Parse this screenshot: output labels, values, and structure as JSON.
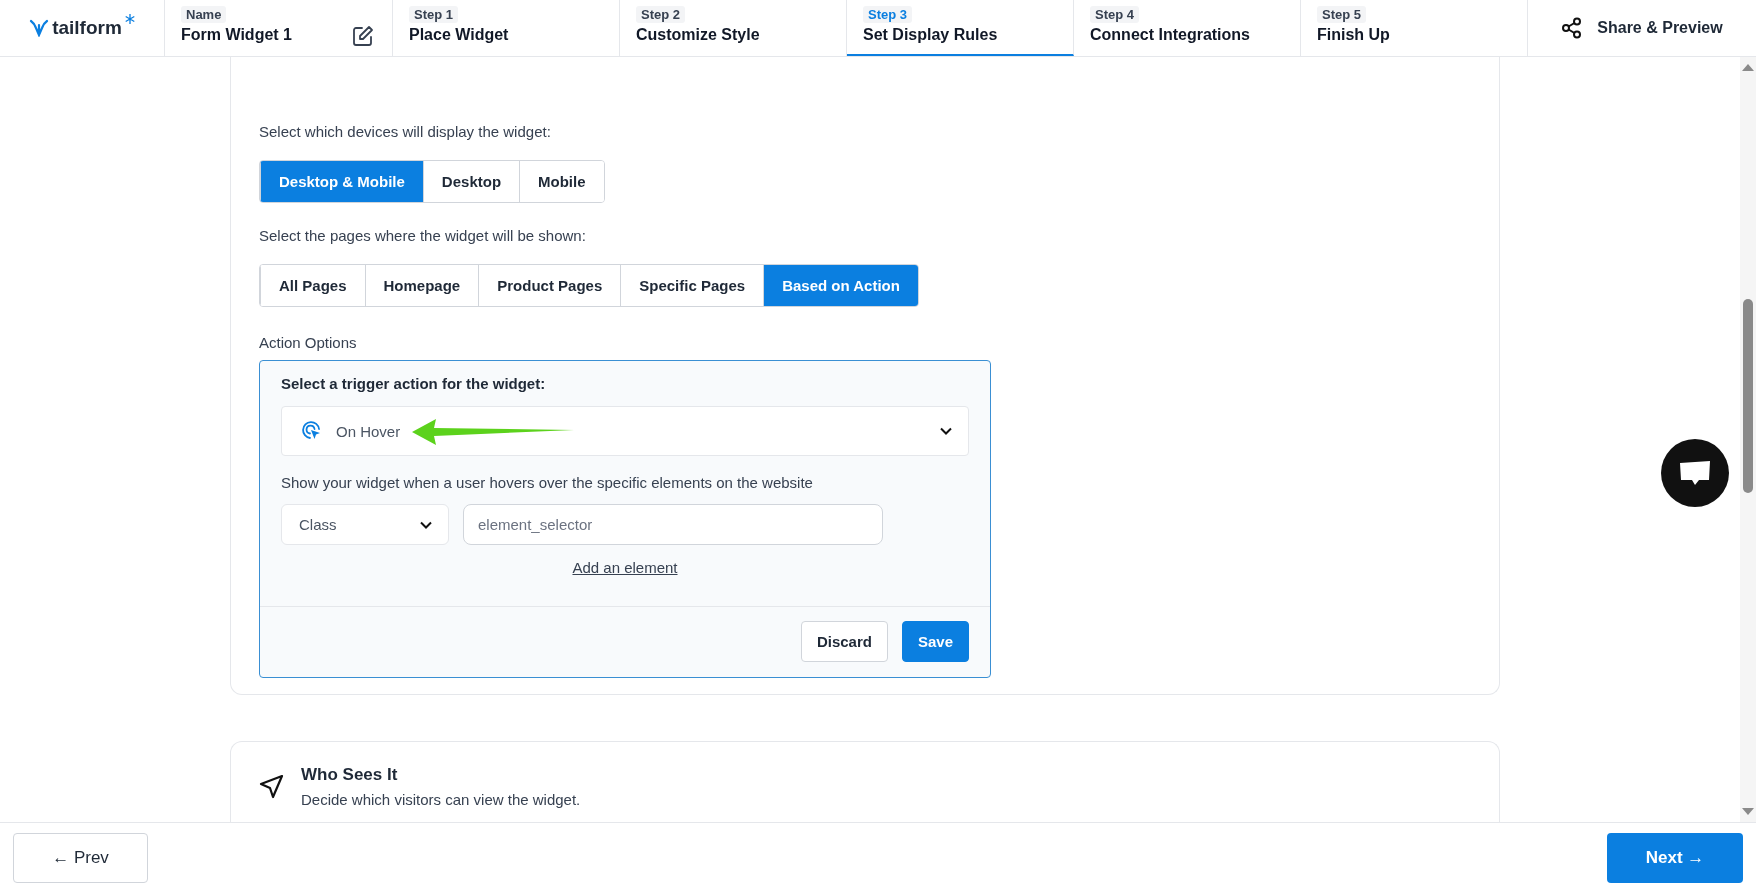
{
  "header": {
    "logo": "tailform",
    "name": {
      "label": "Name",
      "value": "Form Widget 1"
    },
    "steps": [
      {
        "label": "Step 1",
        "title": "Place Widget",
        "selected": false
      },
      {
        "label": "Step 2",
        "title": "Customize Style",
        "selected": false
      },
      {
        "label": "Step 3",
        "title": "Set Display Rules",
        "selected": true
      },
      {
        "label": "Step 4",
        "title": "Connect Integrations",
        "selected": false
      },
      {
        "label": "Step 5",
        "title": "Finish Up",
        "selected": false
      }
    ],
    "share": "Share & Preview"
  },
  "display_rules": {
    "devices": {
      "label": "Select which devices will display the widget:",
      "options": [
        {
          "label": "Desktop & Mobile",
          "selected": true
        },
        {
          "label": "Desktop",
          "selected": false
        },
        {
          "label": "Mobile",
          "selected": false
        }
      ]
    },
    "pages": {
      "label": "Select the pages where the widget will be shown:",
      "options": [
        {
          "label": "All Pages",
          "selected": false
        },
        {
          "label": "Homepage",
          "selected": false
        },
        {
          "label": "Product Pages",
          "selected": false
        },
        {
          "label": "Specific Pages",
          "selected": false
        },
        {
          "label": "Based on Action",
          "selected": true
        }
      ]
    },
    "action_options": {
      "label": "Action Options",
      "trigger_label": "Select a trigger action for the widget:",
      "trigger": "On Hover",
      "description": "Show your widget when a user hovers over the specific elements on the website",
      "selector_type": "Class",
      "selector": {
        "placeholder": "element_selector"
      },
      "add_link": "Add an element",
      "buttons": [
        {
          "label": "Discard",
          "kind": "secondary"
        },
        {
          "label": "Save",
          "kind": "primary"
        }
      ]
    }
  },
  "who_sees_it": {
    "title": "Who Sees It",
    "description": "Decide which visitors can view the widget."
  },
  "footer": {
    "prev": "← Prev",
    "next": "Next →"
  }
}
